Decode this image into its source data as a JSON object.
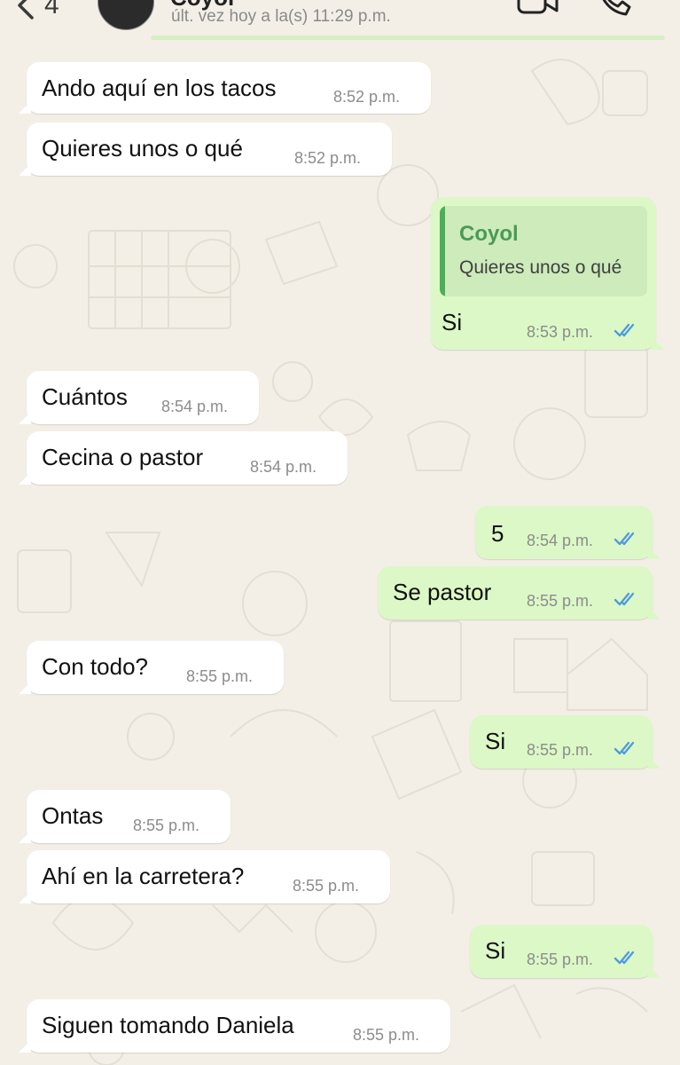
{
  "header": {
    "back_count": "4",
    "contact_name": "Coyol",
    "last_seen": "últ. vez hoy a la(s) 11:29 p.m."
  },
  "colors": {
    "background": "#f3efe7",
    "incoming_bubble": "#ffffff",
    "outgoing_bubble": "#dcf8c6",
    "quote_accent": "#4cae5a",
    "read_ticks": "#4f9ae0"
  },
  "messages": [
    {
      "direction": "in",
      "text": "Ando aquí en los tacos",
      "time": "8:52 p.m."
    },
    {
      "direction": "in",
      "text": "Quieres unos o qué",
      "time": "8:52 p.m."
    },
    {
      "direction": "out",
      "text": "Si",
      "time": "8:53 p.m.",
      "status": "read",
      "reply_author": "Coyol",
      "reply_text": "Quieres unos o qué"
    },
    {
      "direction": "in",
      "text": "Cuántos",
      "time": "8:54 p.m."
    },
    {
      "direction": "in",
      "text": "Cecina o pastor",
      "time": "8:54 p.m."
    },
    {
      "direction": "out",
      "text": "5",
      "time": "8:54 p.m.",
      "status": "read"
    },
    {
      "direction": "out",
      "text": "Se pastor",
      "time": "8:55 p.m.",
      "status": "read"
    },
    {
      "direction": "in",
      "text": "Con todo?",
      "time": "8:55 p.m."
    },
    {
      "direction": "out",
      "text": "Si",
      "time": "8:55 p.m.",
      "status": "read"
    },
    {
      "direction": "in",
      "text": "Ontas",
      "time": "8:55 p.m."
    },
    {
      "direction": "in",
      "text": "Ahí en la carretera?",
      "time": "8:55 p.m."
    },
    {
      "direction": "out",
      "text": "Si",
      "time": "8:55 p.m.",
      "status": "read"
    },
    {
      "direction": "in",
      "text": "Siguen tomando Daniela",
      "time": "8:55 p.m."
    }
  ]
}
